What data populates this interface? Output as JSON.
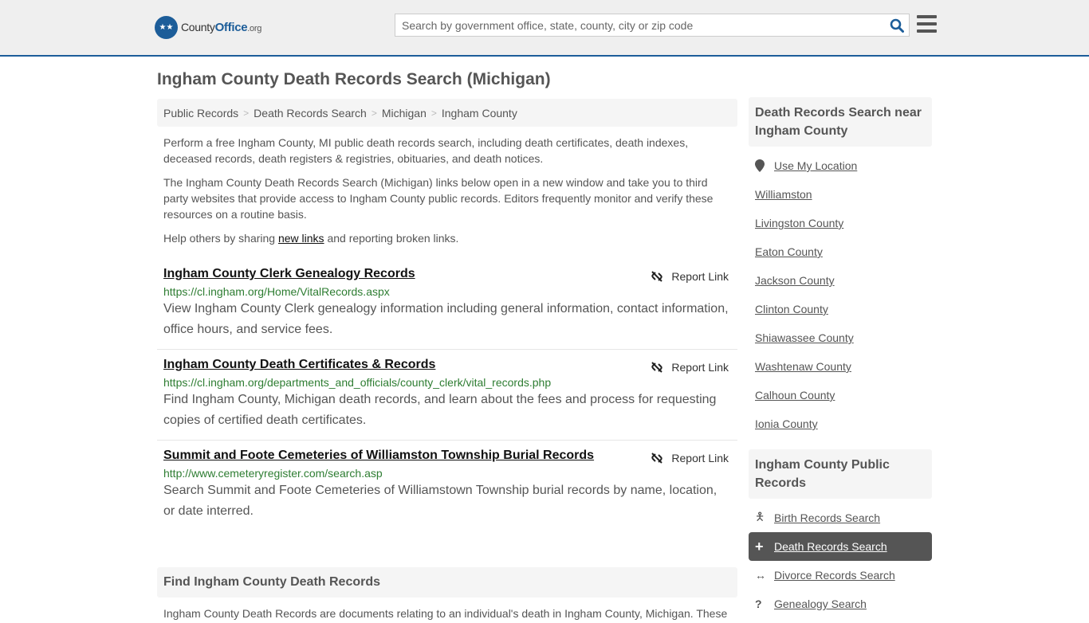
{
  "header": {
    "logo_text_a": "County",
    "logo_text_b": "Office",
    "logo_text_c": ".org",
    "search_placeholder": "Search by government office, state, county, city or zip code"
  },
  "page_title": "Ingham County Death Records Search (Michigan)",
  "breadcrumb": [
    "Public Records",
    "Death Records Search",
    "Michigan",
    "Ingham County"
  ],
  "intro": {
    "p1": "Perform a free Ingham County, MI public death records search, including death certificates, death indexes, deceased records, death registers & registries, obituaries, and death notices.",
    "p2": "The Ingham County Death Records Search (Michigan) links below open in a new window and take you to third party websites that provide access to Ingham County public records. Editors frequently monitor and verify these resources on a routine basis.",
    "p3_a": "Help others by sharing ",
    "p3_link": "new links",
    "p3_b": " and reporting broken links."
  },
  "report_label": "Report Link",
  "entries": [
    {
      "title": "Ingham County Clerk Genealogy Records",
      "url": "https://cl.ingham.org/Home/VitalRecords.aspx",
      "desc": "View Ingham County Clerk genealogy information including general information, contact information, office hours, and service fees."
    },
    {
      "title": "Ingham County Death Certificates & Records",
      "url": "https://cl.ingham.org/departments_and_officials/county_clerk/vital_records.php",
      "desc": "Find Ingham County, Michigan death records, and learn about the fees and process for requesting copies of certified death certificates."
    },
    {
      "title": "Summit and Foote Cemeteries of Williamston Township Burial Records",
      "url": "http://www.cemeteryregister.com/search.asp",
      "desc": "Search Summit and Foote Cemeteries of Williamstown Township burial records by name, location, or date interred."
    }
  ],
  "find": {
    "heading": "Find Ingham County Death Records",
    "text": "Ingham County Death Records are documents relating to an individual's death in Ingham County, Michigan. These"
  },
  "sidebar": {
    "near_heading": "Death Records Search near Ingham County",
    "use_location": "Use My Location",
    "near": [
      "Williamston",
      "Livingston County",
      "Eaton County",
      "Jackson County",
      "Clinton County",
      "Shiawassee County",
      "Washtenaw County",
      "Calhoun County",
      "Ionia County"
    ],
    "public_heading": "Ingham County Public Records",
    "public": [
      {
        "label": "Birth Records Search",
        "icon": "child-icon"
      },
      {
        "label": "Death Records Search",
        "icon": "plus-icon",
        "active": true
      },
      {
        "label": "Divorce Records Search",
        "icon": "arrows-horizontal-icon"
      },
      {
        "label": "Genealogy Search",
        "icon": "question-icon"
      }
    ]
  }
}
